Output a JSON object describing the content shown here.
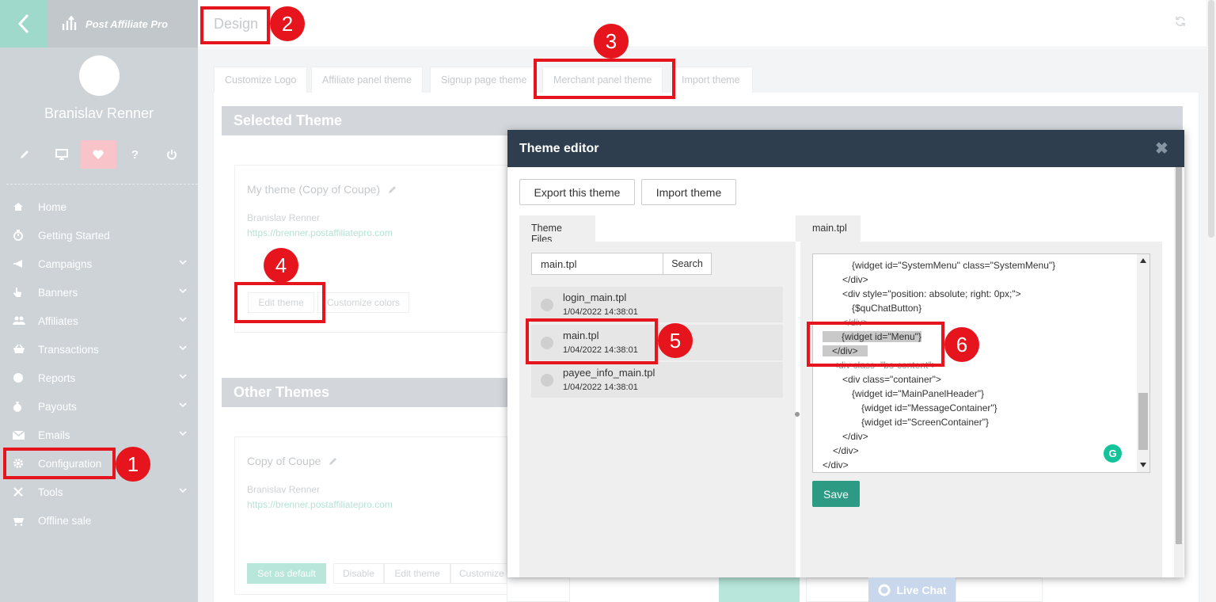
{
  "sidebar": {
    "logo_text": "Post Affiliate Pro",
    "user_name": "Branislav Renner",
    "user_tools": [
      "pencil-icon",
      "monitor-icon",
      "heart-icon",
      "help-icon",
      "power-icon"
    ],
    "nav": [
      {
        "label": "Home",
        "icon": "home-icon",
        "has_submenu": false
      },
      {
        "label": "Getting Started",
        "icon": "stopwatch-icon",
        "has_submenu": false
      },
      {
        "label": "Campaigns",
        "icon": "megaphone-icon",
        "has_submenu": true
      },
      {
        "label": "Banners",
        "icon": "hand-pointer-icon",
        "has_submenu": true
      },
      {
        "label": "Affiliates",
        "icon": "users-icon",
        "has_submenu": true
      },
      {
        "label": "Transactions",
        "icon": "basket-icon",
        "has_submenu": true
      },
      {
        "label": "Reports",
        "icon": "pie-chart-icon",
        "has_submenu": true
      },
      {
        "label": "Payouts",
        "icon": "money-bag-icon",
        "has_submenu": true
      },
      {
        "label": "Emails",
        "icon": "envelope-icon",
        "has_submenu": true
      },
      {
        "label": "Configuration",
        "icon": "gear-icon",
        "has_submenu": false
      },
      {
        "label": "Tools",
        "icon": "tools-icon",
        "has_submenu": true
      },
      {
        "label": "Offline sale",
        "icon": "cart-icon",
        "has_submenu": false
      }
    ]
  },
  "header": {
    "title": "Design"
  },
  "tabs": [
    "Customize Logo",
    "Affiliate panel theme",
    "Signup page theme",
    "Merchant panel theme",
    "Import theme"
  ],
  "selected_theme": {
    "header": "Selected Theme",
    "name": "My theme (Copy of Coupe)",
    "author": "Branislav Renner",
    "url": "https://brenner.postaffiliatepro.com",
    "edit_label": "Edit theme",
    "colors_label": "Customize colors"
  },
  "other_themes": {
    "header": "Other Themes",
    "name": "Copy of Coupe",
    "author": "Branislav Renner",
    "url": "https://brenner.postaffiliatepro.com",
    "set_default_label": "Set as default",
    "disable_label": "Disable",
    "edit_label": "Edit theme",
    "customize_label": "Customize"
  },
  "modal": {
    "title": "Theme editor",
    "close_glyph": "✖",
    "export_label": "Export this theme",
    "import_label": "Import theme",
    "files_tab": "Theme Files",
    "search_value": "main.tpl",
    "search_button": "Search",
    "files": [
      {
        "name": "login_main.tpl",
        "date": "1/04/2022 14:38:01"
      },
      {
        "name": "main.tpl",
        "date": "1/04/2022 14:38:01"
      },
      {
        "name": "payee_info_main.tpl",
        "date": "1/04/2022 14:38:01"
      }
    ],
    "editor_tab": "main.tpl",
    "code_lines": [
      "{widget id=\"SystemMenu\" class=\"SystemMenu\"}",
      "</div>",
      "<div style=\"position: absolute; right: 0px;\">",
      "{$quChatButton}",
      "</div>",
      "{widget id=\"Menu\"}",
      "</div>",
      "<div class=\"bs-content\">",
      "<div class=\"container\">",
      "{widget id=\"MainPanelHeader\"}",
      "{widget id=\"MessageContainer\"}",
      "{widget id=\"ScreenContainer\"}",
      "</div>",
      "</div>",
      "</div>"
    ],
    "save_label": "Save"
  },
  "live_chat": "Live Chat",
  "annotations": [
    "1",
    "2",
    "3",
    "4",
    "5",
    "6"
  ],
  "colors": {
    "annotation_red": "#e6141d",
    "modal_header": "#2f3e4e",
    "save_green": "#2d9b83",
    "sidebar_bg": "#cdd3d7"
  }
}
